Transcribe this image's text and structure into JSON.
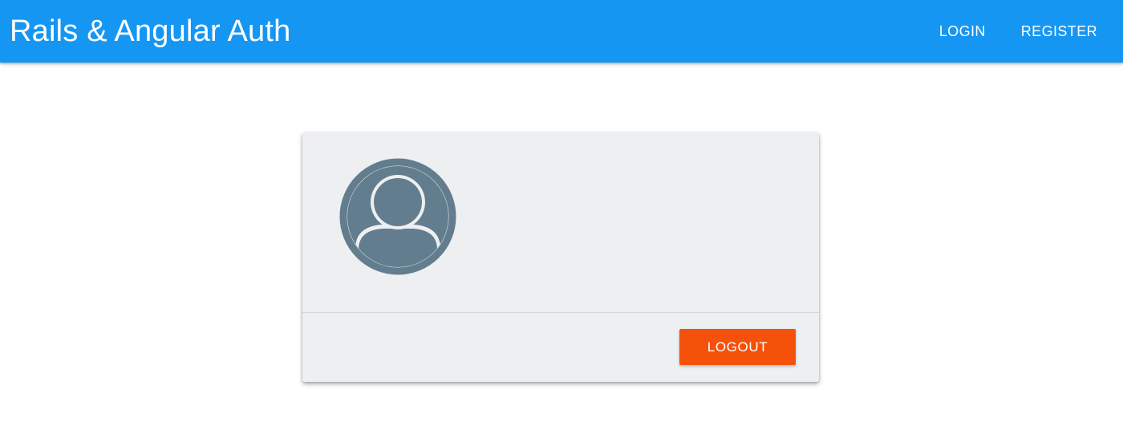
{
  "header": {
    "title": "Rails & Angular Auth",
    "nav": {
      "login_label": "LOGIN",
      "register_label": "REGISTER"
    }
  },
  "profile_card": {
    "avatar_icon": "account-circle-icon",
    "logout_label": "LOGOUT"
  },
  "colors": {
    "toolbar": "#1596f3",
    "card_background": "#eeeff1",
    "avatar": "#627d8e",
    "logout_button": "#f4510b"
  }
}
